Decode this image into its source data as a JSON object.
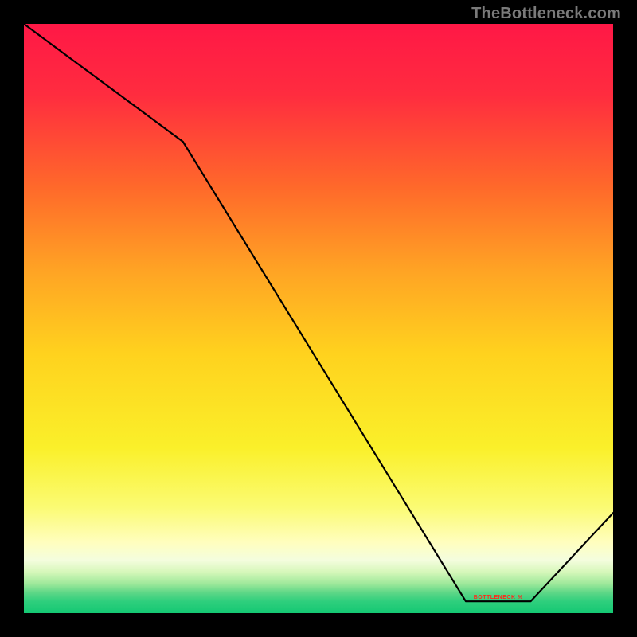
{
  "attribution": "TheBottleneck.com",
  "annotation": {
    "text": "BOTTLENECK %",
    "x_fraction_of_plot": 0.805,
    "y_fraction_of_plot": 0.98
  },
  "chart_data": {
    "type": "line",
    "title": "",
    "xlabel": "",
    "ylabel": "",
    "xlim": [
      0,
      1
    ],
    "ylim": [
      0,
      1
    ],
    "series": [
      {
        "name": "line",
        "x": [
          0.0,
          0.27,
          0.75,
          0.86,
          1.0
        ],
        "values": [
          1.0,
          0.8,
          0.02,
          0.02,
          0.17
        ]
      }
    ],
    "background_gradient_stops": [
      {
        "offset": 0.0,
        "color": "#ff1846"
      },
      {
        "offset": 0.12,
        "color": "#ff2c3f"
      },
      {
        "offset": 0.28,
        "color": "#ff6a2a"
      },
      {
        "offset": 0.42,
        "color": "#ffa424"
      },
      {
        "offset": 0.56,
        "color": "#ffd21e"
      },
      {
        "offset": 0.72,
        "color": "#faf02a"
      },
      {
        "offset": 0.82,
        "color": "#fbfb73"
      },
      {
        "offset": 0.88,
        "color": "#fffebe"
      },
      {
        "offset": 0.91,
        "color": "#f4fdde"
      },
      {
        "offset": 0.93,
        "color": "#d6f7ba"
      },
      {
        "offset": 0.95,
        "color": "#9fe99b"
      },
      {
        "offset": 0.965,
        "color": "#5fd787"
      },
      {
        "offset": 0.98,
        "color": "#2fcf7d"
      },
      {
        "offset": 1.0,
        "color": "#14c873"
      }
    ],
    "line_color": "#000000"
  }
}
